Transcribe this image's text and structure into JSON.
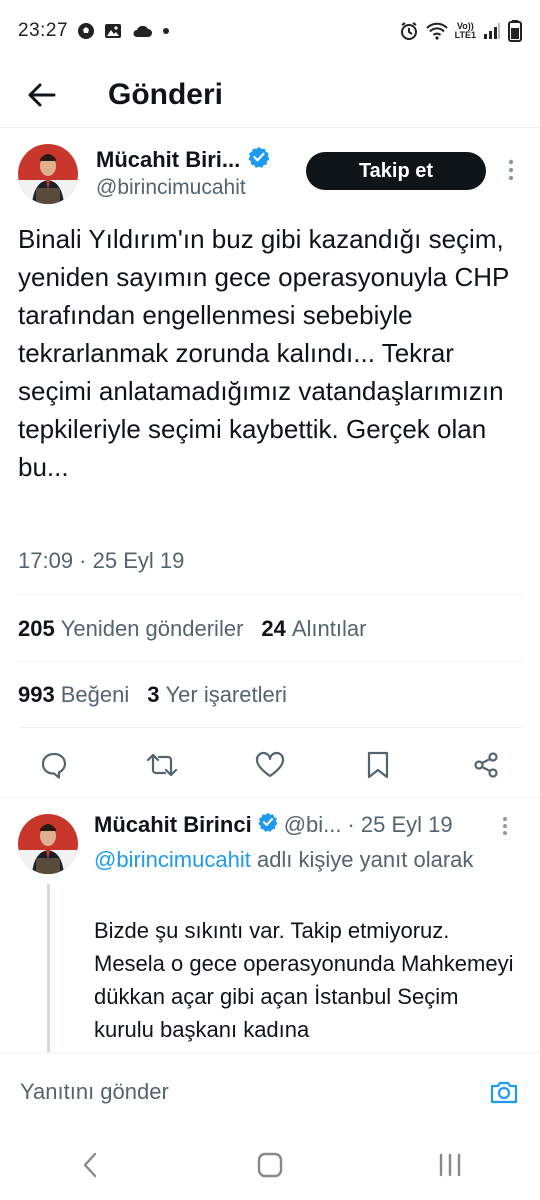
{
  "status_bar": {
    "time": "23:27",
    "network_label_top": "Vo))",
    "network_label_bottom": "LTE1"
  },
  "header": {
    "title": "Gönderi"
  },
  "post": {
    "author_name": "Mücahit Biri...",
    "author_handle": "@birincimucahit",
    "follow_label": "Takip et",
    "text": "Binali Yıldırım'ın buz gibi kazandığı seçim, yeniden sayımın gece operasyonuyla CHP tarafından engellenmesi sebebiyle tekrarlanmak zorunda kalındı... Tekrar seçimi anlatamadığımız vatandaşlarımızın tepkileriyle seçimi kaybettik. Gerçek olan bu...",
    "timestamp": "17:09 · 25 Eyl 19",
    "reposts_count": "205",
    "reposts_label": "Yeniden gönderiler",
    "quotes_count": "24",
    "quotes_label": "Alıntılar",
    "likes_count": "993",
    "likes_label": "Beğeni",
    "bookmarks_count": "3",
    "bookmarks_label": "Yer işaretleri"
  },
  "reply": {
    "author_name": "Mücahit Birinci",
    "author_handle": "@bi...",
    "date": "· 25 Eyl 19",
    "mention": "@birincimucahit",
    "reply_to_suffix": "adlı kişiye yanıt olarak",
    "text": "Bizde şu sıkıntı var. Takip etmiyoruz. Mesela o gece operasyonunda Mahkemeyi dükkan açar gibi açan İstanbul Seçim kurulu başkanı kadına"
  },
  "composer": {
    "placeholder": "Yanıtını gönder"
  },
  "colors": {
    "accent": "#1d9bf0",
    "text_primary": "#0f1419",
    "text_secondary": "#536471",
    "follow_bg": "#0f1419"
  }
}
